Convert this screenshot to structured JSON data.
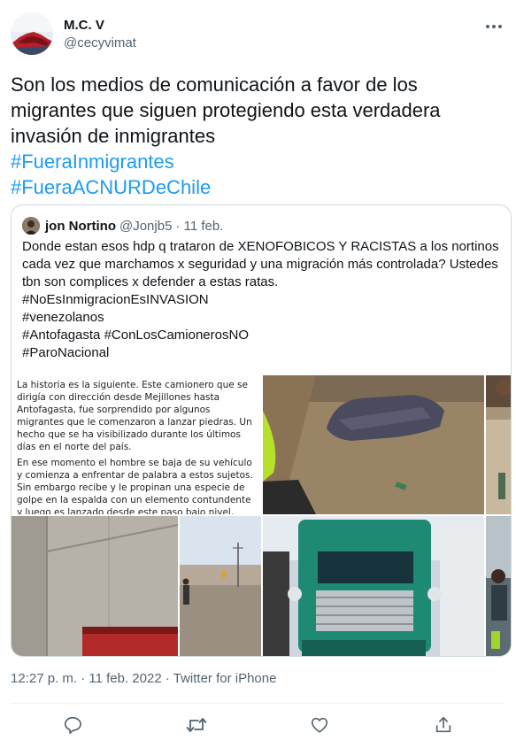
{
  "author": {
    "name": "M.C. V",
    "handle": "@cecyvimat"
  },
  "tweet": {
    "text": "Son los medios de comunicación a favor de los migrantes que siguen protegiendo esta verdadera invasión de inmigrantes",
    "hashtags": [
      "#FueraInmigrantes",
      "#FueraACNURDeChile"
    ]
  },
  "quoted": {
    "name": "jon Nortino",
    "handle": "@Jonjb5",
    "date": "· 11 feb.",
    "lines": [
      "Donde estan esos hdp q trataron de XENOFOBICOS Y RACISTAS a los nortinos cada vez que marchamos x seguridad y una migración más controlada? Ustedes tbn son complices x defender a estas ratas.",
      "#NoEsInmigracionEsINVASION",
      "#venezolanos",
      "#Antofagasta #ConLosCamionerosNO",
      "#ParoNacional"
    ],
    "media_text": [
      "La historia es la siguiente. Este camionero que se dirigía con dirección desde Mejillones hasta Antofagasta, fue sorprendido por algunos migrantes que le comenzaron a lanzar piedras. Un hecho que se ha visibilizado durante los últimos días en el norte del país.",
      "En ese momento el hombre se baja de su vehículo y comienza a enfrentar de palabra a estos sujetos. Sin embargo recibe y le propinan una especie de golpe en la espalda con un elemento contundente y luego es lanzado desde este paso bajo nivel, donde finalmente"
    ]
  },
  "meta": {
    "timestamp": "12:27 p. m. · 11 feb. 2022 · Twitter for iPhone"
  },
  "icons": {
    "more": "more-icon",
    "reply": "reply-icon",
    "retweet": "retweet-icon",
    "like": "like-icon",
    "share": "share-icon"
  },
  "colors": {
    "link": "#1d9bf0",
    "secondary": "#536471",
    "border": "#cfd9de"
  }
}
